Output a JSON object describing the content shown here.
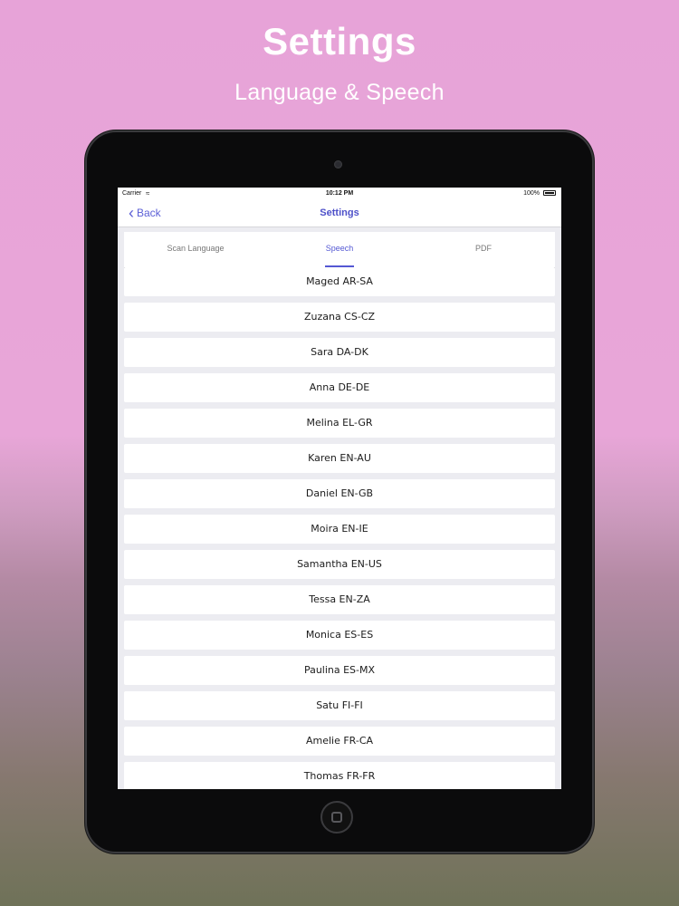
{
  "headline": {
    "title": "Settings",
    "subtitle": "Language & Speech"
  },
  "status_bar": {
    "carrier": "Carrier",
    "time": "10:12 PM",
    "battery": "100%"
  },
  "nav_bar": {
    "back_label": "Back",
    "title": "Settings"
  },
  "tabs": [
    {
      "label": "Scan Language",
      "active": false
    },
    {
      "label": "Speech",
      "active": true
    },
    {
      "label": "PDF",
      "active": false
    }
  ],
  "voices": [
    "Maged AR-SA",
    "Zuzana CS-CZ",
    "Sara DA-DK",
    "Anna DE-DE",
    "Melina EL-GR",
    "Karen EN-AU",
    "Daniel EN-GB",
    "Moira EN-IE",
    "Samantha EN-US",
    "Tessa EN-ZA",
    "Monica ES-ES",
    "Paulina ES-MX",
    "Satu FI-FI",
    "Amelie FR-CA",
    "Thomas FR-FR"
  ],
  "colors": {
    "accent": "#5458d3",
    "background_top": "#e7a3d8",
    "background_bottom": "#6f7258"
  }
}
